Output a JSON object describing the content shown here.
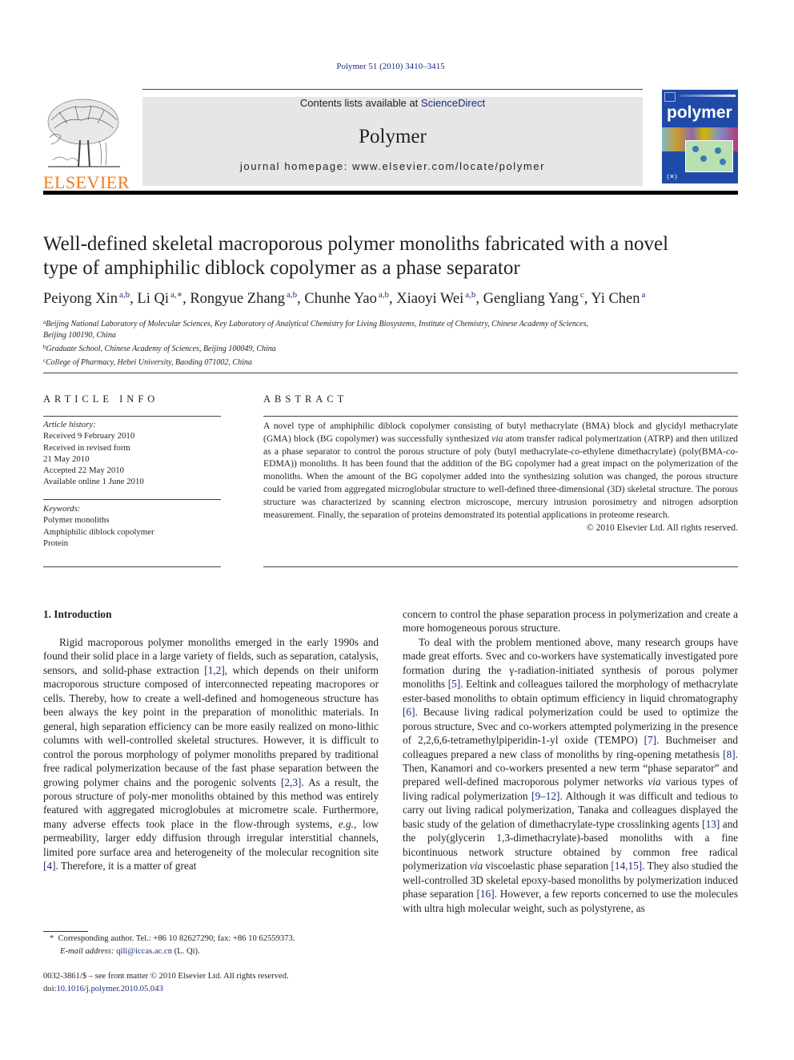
{
  "header": {
    "citation": "Polymer 51 (2010) 3410–3415",
    "contents_prefix": "Contents lists available at ",
    "contents_link": "ScienceDirect",
    "journal_name": "Polymer",
    "homepage": "journal homepage: www.elsevier.com/locate/polymer",
    "publisher_logo_text": "ELSEVIER",
    "cover_title": "polymer",
    "colors": {
      "link": "#1f2b7a",
      "elsevier_orange": "#f07c1b",
      "cover_blue": "#1f4aa8",
      "header_gray": "#e6e6e6"
    }
  },
  "article": {
    "title_line1": "Well-defined skeletal macroporous polymer monoliths fabricated with a novel",
    "title_line2": "type of amphiphilic diblock copolymer as a phase separator",
    "authors": [
      {
        "name": "Peiyong Xin",
        "aff": "a,b"
      },
      {
        "name": "Li Qi",
        "aff": "a,∗"
      },
      {
        "name": "Rongyue Zhang",
        "aff": "a,b"
      },
      {
        "name": "Chunhe Yao",
        "aff": "a,b"
      },
      {
        "name": "Xiaoyi Wei",
        "aff": "a,b"
      },
      {
        "name": "Gengliang Yang",
        "aff": "c"
      },
      {
        "name": "Yi Chen",
        "aff": "a"
      }
    ],
    "affiliations": [
      {
        "key": "a",
        "line1": "Beijing National Laboratory of Molecular Sciences, Key Laboratory of Analytical Chemistry for Living Biosystems, Institute of Chemistry, Chinese Academy of Sciences,",
        "line2": "Beijing 100190, China"
      },
      {
        "key": "b",
        "line1": "Graduate School, Chinese Academy of Sciences, Beijing 100049, China"
      },
      {
        "key": "c",
        "line1": "College of Pharmacy, Hebei University, Baoding 071002, China"
      }
    ]
  },
  "article_info": {
    "heading": "ARTICLE INFO",
    "history_label": "Article history:",
    "history": [
      "Received 9 February 2010",
      "Received in revised form",
      "21 May 2010",
      "Accepted 22 May 2010",
      "Available online 1 June 2010"
    ],
    "keywords_label": "Keywords:",
    "keywords": [
      "Polymer monoliths",
      "Amphiphilic diblock copolymer",
      "Protein"
    ]
  },
  "abstract": {
    "heading": "ABSTRACT",
    "text_1": "A novel type of amphiphilic diblock copolymer consisting of butyl methacrylate (BMA) block and glycidyl methacrylate (GMA) block (BG copolymer) was successfully synthesized ",
    "via": "via",
    "text_2": " atom transfer radical polymerization (ATRP) and then utilized as a phase separator to control the porous structure of poly (butyl methacrylate-",
    "co1": "co",
    "text_3": "-ethylene dimethacrylate) (poly(BMA-",
    "co2": "co",
    "text_4": "-EDMA)) monoliths. It has been found that the addition of the BG copolymer had a great impact on the polymerization of the monoliths. When the amount of the BG copolymer added into the synthesizing solution was changed, the porous structure could be varied from aggregated microglobular structure to well-defined three-dimensional (3D) skeletal structure. The porous structure was characterized by scanning electron microscope, mercury intrusion porosimetry and nitrogen adsorption measurement. Finally, the separation of proteins demonstrated its potential applications in proteome research.",
    "copyright": "© 2010 Elsevier Ltd. All rights reserved."
  },
  "intro": {
    "heading": "1.  Introduction",
    "p1_a": "Rigid macroporous polymer monoliths emerged in the early 1990s and found their solid place in a large variety of fields, such as separation, catalysis, sensors, and solid-phase extraction ",
    "ref_1_2": "[1,2]",
    "p1_b": ", which depends on their uniform macroporous structure composed of interconnected repeating macropores or cells. Thereby, how to create a well-defined and homogeneous structure has been always the key point in the preparation of monolithic materials. In general, high separation efficiency can be more easily realized on mono-lithic columns with well-controlled skeletal structures. However, it is difficult to control the porous morphology of polymer monoliths prepared by traditional free radical polymerization because of the fast phase separation between the growing polymer chains and the porogenic solvents ",
    "ref_2_3": "[2,3]",
    "p1_c": ". As a result, the porous structure of poly-mer monoliths obtained by this method was entirely featured with aggregated microglobules at micrometre scale. Furthermore, many adverse effects took place in the flow-through systems, ",
    "eg": "e.g.",
    "p1_d": ", low permeability, larger eddy diffusion through irregular interstitial channels, limited pore surface area and heterogeneity of the molecular recognition site ",
    "ref_4": "[4]",
    "p1_e": ". Therefore, it is a matter of great",
    "p1_cont": "concern to control the phase separation process in polymerization and create a more homogeneous porous structure.",
    "p2_a": "To deal with the problem mentioned above, many research groups have made great efforts. Svec and co-workers have systematically investigated pore formation during the γ-radiation-initiated synthesis of porous polymer monoliths ",
    "ref_5": "[5]",
    "p2_b": ". Eeltink and colleagues tailored the morphology of methacrylate ester-based monoliths to obtain optimum efficiency in liquid chromatography ",
    "ref_6": "[6]",
    "p2_c": ". Because living radical polymerization could be used to optimize the porous structure, Svec and co-workers attempted polymerizing in the presence of 2,2,6,6-tetramethylpiperidin-1-yl oxide (TEMPO) ",
    "ref_7": "[7]",
    "p2_d": ". Buchmeiser and colleagues prepared a new class of monoliths by ring-opening metathesis ",
    "ref_8": "[8]",
    "p2_e": ". Then, Kanamori and co-workers presented a new term “phase separator” and prepared well-defined macroporous polymer networks ",
    "via": "via",
    "p2_f": " various types of living radical polymerization ",
    "ref_9_12": "[9–12]",
    "p2_g": ". Although it was difficult and tedious to carry out living radical polymerization, Tanaka and colleagues displayed the basic study of the gelation of dimethacrylate-type crosslinking agents ",
    "ref_13": "[13]",
    "p2_h": " and the poly(glycerin 1,3-dimethacrylate)-based monoliths with a fine bicontinuous network structure obtained by common free radical polymerization ",
    "p2_i": " viscoelastic phase separation ",
    "ref_14_15": "[14,15]",
    "p2_j": ". They also studied the well-controlled 3D skeletal epoxy-based monoliths by polymerization induced phase separation ",
    "ref_16": "[16]",
    "p2_k": ". However, a few reports concerned to use the molecules with ultra high molecular weight, such as polystyrene, as"
  },
  "footnote": {
    "star": "*",
    "corresponding": "Corresponding author. Tel.: +86 10 82627290; fax: +86 10 62559373.",
    "email_label": "E-mail address:",
    "email": "qili@iccas.ac.cn",
    "email_suffix": " (L. Qi)."
  },
  "bottom": {
    "issn": "0032-3861/$ – see front matter © 2010 Elsevier Ltd. All rights reserved.",
    "doi_prefix": "doi:",
    "doi": "10.1016/j.polymer.2010.05.043"
  }
}
